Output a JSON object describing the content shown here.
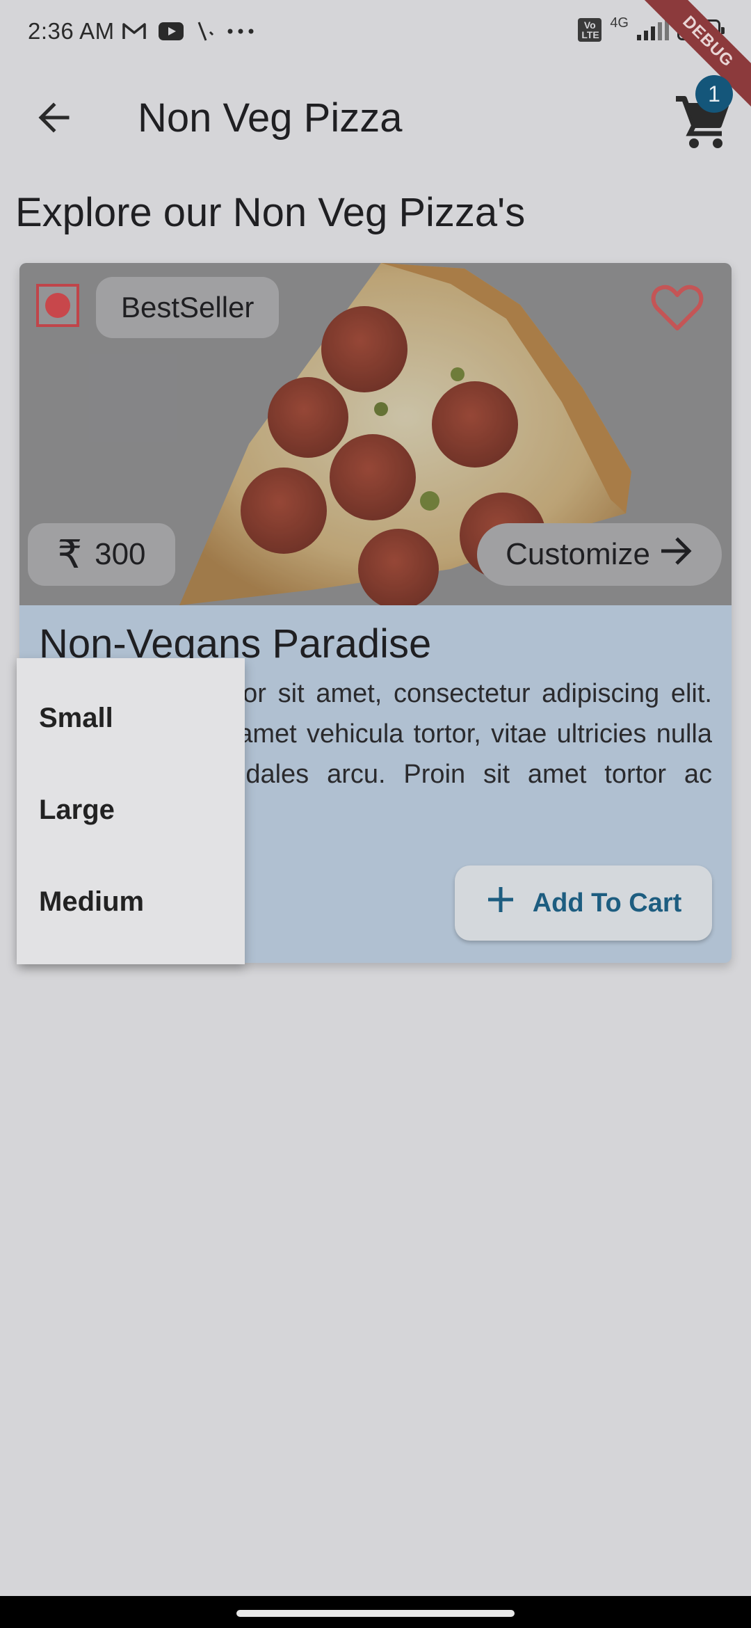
{
  "status_bar": {
    "time": "2:36 AM",
    "icons_left": [
      "gmail-icon",
      "youtube-icon",
      "signal-slash-icon",
      "more-dots-icon"
    ],
    "volte_label": "Vo LTE",
    "network_label": "4G",
    "battery_label": "46",
    "icons_right": [
      "volte-icon",
      "signal-icon",
      "battery-icon"
    ]
  },
  "debug_banner": "DEBUG",
  "app_bar": {
    "back_icon": "arrow-back-icon",
    "title": "Non Veg Pizza",
    "cart_icon": "shopping-cart-icon",
    "cart_count": "1"
  },
  "section_heading": "Explore our Non Veg Pizza's",
  "product_card": {
    "image_desc": "pepperoni pizza slice",
    "badge": "BestSeller",
    "favorite_icon": "heart-outline-icon",
    "price_icon": "rupee-icon",
    "price": "300",
    "customize_label": "Customize",
    "customize_icon": "arrow-forward-icon",
    "title": "Non-Vegans Paradise",
    "description": "Lorem ipsum dolor sit amet, consectetur adipiscing elit. Pellentesque sit amet vehicula tortor, vitae ultricies nulla risus. Sed a sodales arcu. Proin sit amet tortor ac venenatis.",
    "add_to_cart_icon": "plus-icon",
    "add_to_cart_label": "Add To Cart"
  },
  "size_menu": {
    "items": [
      "Small",
      "Large",
      "Medium"
    ]
  },
  "colors": {
    "background": "#d5d5d8",
    "card_body": "#b0c0d1",
    "accent": "#14567a",
    "veg_indicator": "#c8474b"
  }
}
